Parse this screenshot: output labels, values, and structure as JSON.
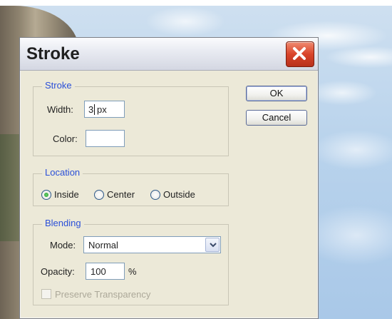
{
  "dialog": {
    "title": "Stroke",
    "ok_label": "OK",
    "cancel_label": "Cancel"
  },
  "stroke_group": {
    "legend": "Stroke",
    "width_label": "Width:",
    "width_value": "3",
    "width_unit": "px",
    "color_label": "Color:"
  },
  "location_group": {
    "legend": "Location",
    "options": [
      "Inside",
      "Center",
      "Outside"
    ],
    "selected": "Inside"
  },
  "blending_group": {
    "legend": "Blending",
    "mode_label": "Mode:",
    "mode_value": "Normal",
    "opacity_label": "Opacity:",
    "opacity_value": "100",
    "opacity_unit": "%",
    "preserve_label": "Preserve Transparency",
    "preserve_checked": false,
    "preserve_enabled": false
  },
  "colors": {
    "legend_text": "#2a4fd8",
    "close_button": "#d9442a",
    "stroke_color_swatch": "#ffffff"
  }
}
